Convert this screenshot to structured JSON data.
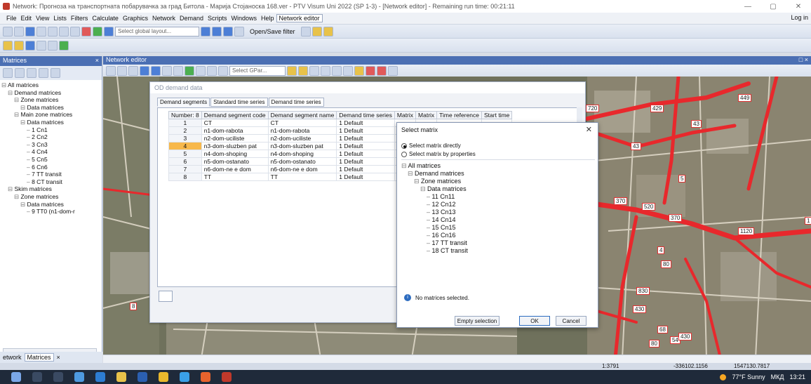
{
  "window": {
    "title": "Network: Прогноза на транспортната побарувачка за град Битола - Марија Стојаноска 168.ver - PTV Visum Uni 2022 (SP 1-3) - [Network editor] - Remaining run time: 00:21:11",
    "minimize": "—",
    "maximize": "▢",
    "close": "✕"
  },
  "menu": {
    "items": [
      "File",
      "Edit",
      "View",
      "Lists",
      "Filters",
      "Calculate",
      "Graphics",
      "Network",
      "Demand",
      "Scripts",
      "Windows",
      "Help",
      "Network editor"
    ],
    "login": "Log in"
  },
  "toolbar": {
    "layout_placeholder": "Select global layout...",
    "open_save_filter": "Open/Save filter"
  },
  "matrices_panel": {
    "title": "Matrices",
    "close": "×",
    "tree": [
      {
        "label": "All matrices",
        "indent": 0
      },
      {
        "label": "Demand matrices",
        "indent": 1
      },
      {
        "label": "Zone matrices",
        "indent": 2
      },
      {
        "label": "Data matrices",
        "indent": 3
      },
      {
        "label": "Main zone matrices",
        "indent": 2
      },
      {
        "label": "Data matrices",
        "indent": 3
      },
      {
        "label": "1 Cn1",
        "indent": 4
      },
      {
        "label": "2 Cn2",
        "indent": 4
      },
      {
        "label": "3 Cn3",
        "indent": 4
      },
      {
        "label": "4 Cn4",
        "indent": 4
      },
      {
        "label": "5 Cn5",
        "indent": 4
      },
      {
        "label": "6 Cn6",
        "indent": 4
      },
      {
        "label": "7 TT transit",
        "indent": 4
      },
      {
        "label": "8 CT transit",
        "indent": 4
      },
      {
        "label": "Skim matrices",
        "indent": 1
      },
      {
        "label": "Zone matrices",
        "indent": 2
      },
      {
        "label": "Data matrices",
        "indent": 3
      },
      {
        "label": "9 TT0 (n1-dom-r",
        "indent": 4
      }
    ],
    "tabs": {
      "network": "etwork",
      "matrices": "Matrices",
      "close": "×"
    }
  },
  "network_editor": {
    "title": "Network editor",
    "close": "□ ×",
    "gpar_placeholder": "Select GPar..."
  },
  "od_window": {
    "title": "OD demand data",
    "tabs": [
      "Demand segments",
      "Standard time series",
      "Demand time series"
    ],
    "columns": [
      "Number: 8",
      "Demand segment code",
      "Demand segment name",
      "Demand time series",
      "Matrix",
      "Matrix",
      "Time reference",
      "Start time"
    ],
    "rows": [
      [
        "1",
        "CT",
        "CT",
        "1 Default"
      ],
      [
        "2",
        "n1-dom-rabota",
        "n1-dom-rabota",
        "1 Default"
      ],
      [
        "3",
        "n2-dom-uciliste",
        "n2-dom-uciliste",
        "1 Default"
      ],
      [
        "4",
        "n3-dom-sluzben pat",
        "n3-dom-sluzben pat",
        "1 Default"
      ],
      [
        "5",
        "n4-dom-shoping",
        "n4-dom-shoping",
        "1 Default"
      ],
      [
        "6",
        "n5-dom-ostanato",
        "n5-dom-ostanato",
        "1 Default"
      ],
      [
        "7",
        "n6-dom-ne e dom",
        "n6-dom-ne e dom",
        "1 Default"
      ],
      [
        "8",
        "TT",
        "TT",
        "1 Default"
      ]
    ],
    "selected_row": 3
  },
  "select_matrix": {
    "title": "Select matrix",
    "close": "✕",
    "option_direct": "Select matrix directly",
    "option_props": "Select matrix by properties",
    "tree": [
      {
        "label": "All matrices",
        "indent": 0
      },
      {
        "label": "Demand matrices",
        "indent": 1
      },
      {
        "label": "Zone matrices",
        "indent": 2
      },
      {
        "label": "Data matrices",
        "indent": 3
      },
      {
        "label": "11 Cn11",
        "indent": 4
      },
      {
        "label": "12 Cn12",
        "indent": 4
      },
      {
        "label": "13 Cn13",
        "indent": 4
      },
      {
        "label": "14 Cn14",
        "indent": 4
      },
      {
        "label": "15 Cn15",
        "indent": 4
      },
      {
        "label": "16 Cn16",
        "indent": 4
      },
      {
        "label": "17 TT transit",
        "indent": 4
      },
      {
        "label": "18 CT transit",
        "indent": 4
      }
    ],
    "status": "No matrices selected.",
    "btn_empty": "Empty selection",
    "btn_ok": "OK",
    "btn_cancel": "Cancel"
  },
  "map_labels": [
    "720",
    "429",
    "449",
    "43",
    "43",
    "5",
    "370",
    "520",
    "370",
    "1120",
    "4",
    "80",
    "830",
    "430",
    "68",
    "54",
    "80",
    "430",
    "8",
    "1"
  ],
  "statusbar": {
    "scale": "1:3791",
    "x": "-336102.1156",
    "y": "1547130.7817"
  },
  "taskbar": {
    "weather": "77°F Sunny",
    "lang": "МКД",
    "time": "13:21"
  },
  "colors": {
    "road": "#e8282c",
    "panel_header": "#4b6fb3",
    "selected_row": "#f7b84b"
  }
}
